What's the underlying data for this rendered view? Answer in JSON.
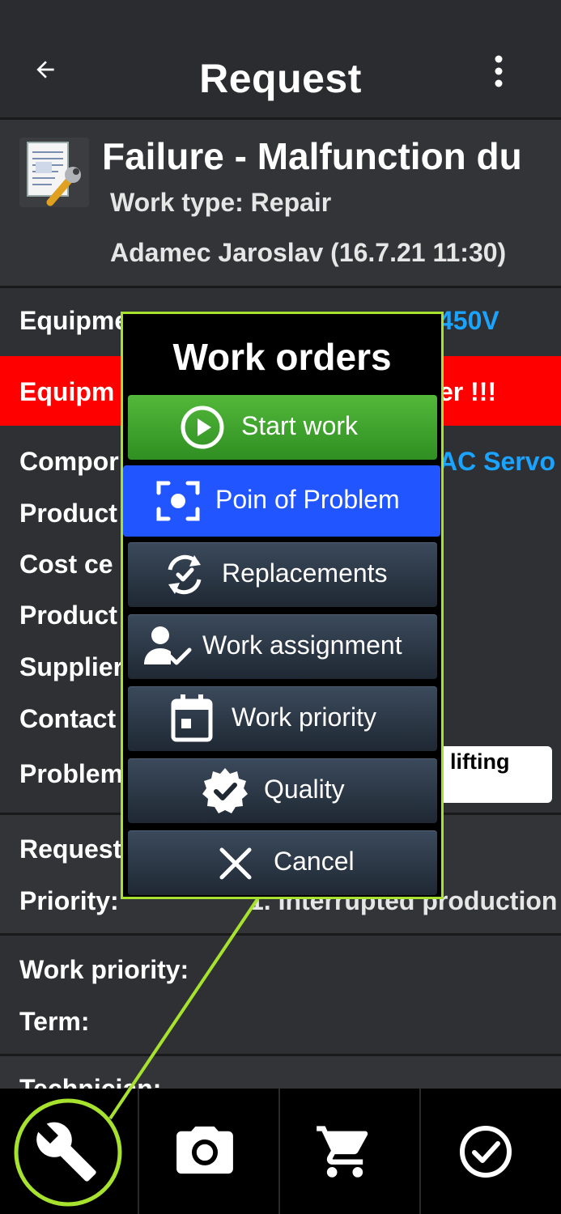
{
  "header": {
    "title": "Request"
  },
  "request": {
    "title": "Failure -  Malfunction du",
    "work_type": "Work type: Repair",
    "author": "Adamec Jaroslav (16.7.21 11:30)"
  },
  "fields": {
    "equipment_label": "Equipme",
    "equipment_value": "450V",
    "equipment_warning_left": "Equipm",
    "equipment_warning_right": "er !!!",
    "component_label": "Compor",
    "component_value": "AC Servo",
    "product1_label": "Product",
    "cost_center_label": "Cost ce",
    "product2_label": "Product",
    "supplier_label": "Supplier",
    "contact_label": "Contact",
    "problem_label": "Problem",
    "problem_value": "lifting",
    "requested_label": "Request",
    "priority_label": "Priority:",
    "priority_value": "1. Interrupted production",
    "work_priority_label": "Work priority:",
    "term_label": "Term:",
    "technician_label": "Technician:"
  },
  "dialog": {
    "title": "Work orders",
    "items": [
      {
        "label": "Start work",
        "icon": "play-circle-icon"
      },
      {
        "label": "Poin of Problem",
        "icon": "focus-point-icon"
      },
      {
        "label": "Replacements",
        "icon": "replace-cycle-icon"
      },
      {
        "label": "Work assignment",
        "icon": "user-check-icon"
      },
      {
        "label": "Work priority",
        "icon": "calendar-icon"
      },
      {
        "label": "Quality",
        "icon": "quality-badge-icon"
      },
      {
        "label": "Cancel",
        "icon": "close-icon"
      }
    ]
  },
  "bottom_bar": {
    "items": [
      "wrench-icon",
      "camera-icon",
      "cart-icon",
      "check-circle-icon"
    ]
  },
  "colors": {
    "accent_highlight": "#a6e22e",
    "start_green": "#3fa52c",
    "problem_blue": "#2155ff",
    "warning_red": "#ff0000",
    "link_blue": "#1aa3ff"
  }
}
